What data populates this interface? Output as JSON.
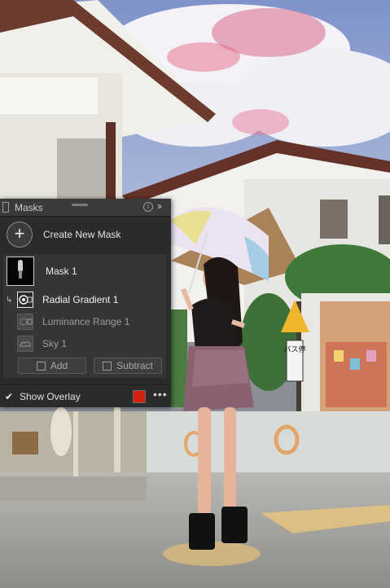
{
  "panel": {
    "title": "Masks",
    "help_icon": "info-icon",
    "collapse_icon": "double-chevron-right-icon",
    "create_label": "Create New Mask",
    "mask": {
      "name": "Mask 1"
    },
    "components": [
      {
        "label": "Radial Gradient 1",
        "icon": "radial-gradient-icon",
        "state": "selected"
      },
      {
        "label": "Luminance Range 1",
        "icon": "luminance-range-icon",
        "state": "normal"
      },
      {
        "label": "Sky 1",
        "icon": "sky-icon",
        "state": "normal"
      }
    ],
    "add_label": "Add",
    "subtract_label": "Subtract",
    "show_overlay_label": "Show Overlay",
    "show_overlay_checked": true,
    "overlay_color": "#d6200e"
  },
  "scene": {
    "sign_text": "バス停"
  }
}
